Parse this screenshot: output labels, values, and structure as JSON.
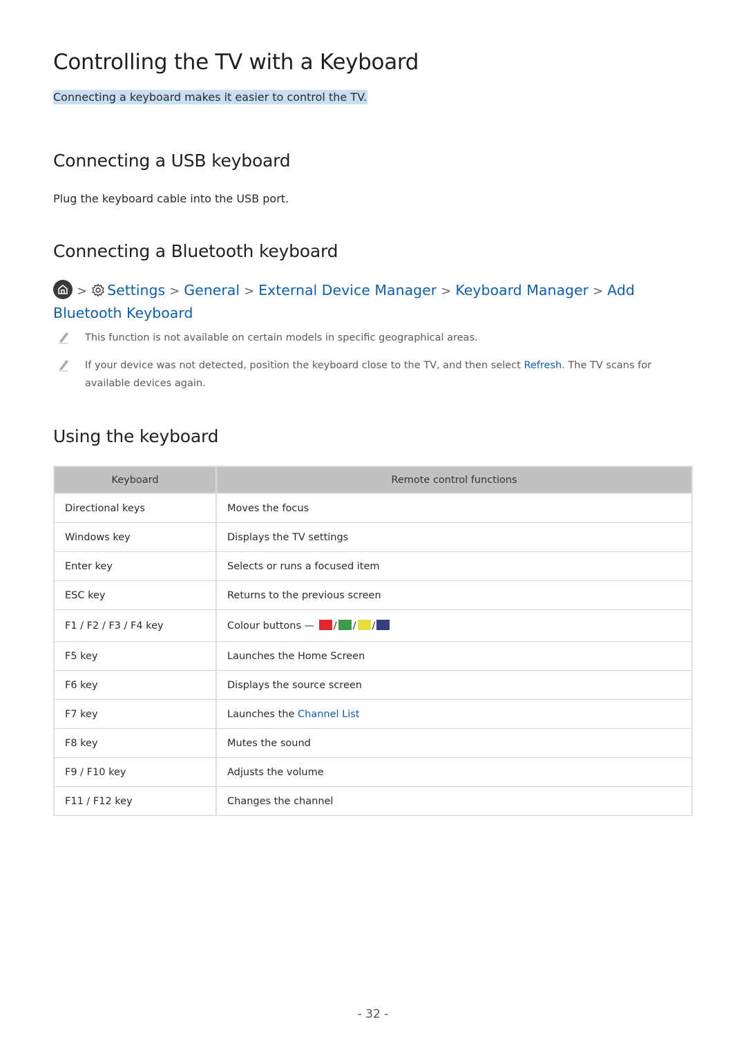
{
  "title": "Controlling the TV with a Keyboard",
  "intro": "Connecting a keyboard makes it easier to control the TV.",
  "sections": {
    "usb": {
      "heading": "Connecting a USB keyboard",
      "text": "Plug the keyboard cable into the USB port."
    },
    "bluetooth": {
      "heading": "Connecting a Bluetooth keyboard",
      "path": {
        "home_icon": "home-icon",
        "settings_icon": "gear-icon",
        "items": [
          "Settings",
          "General",
          "External Device Manager",
          "Keyboard Manager",
          "Add Bluetooth Keyboard"
        ]
      },
      "notes": [
        {
          "icon": "pencil-icon",
          "text": "This function is not available on certain models in specific geographical areas."
        },
        {
          "icon": "pencil-icon",
          "text_before": "If your device was not detected, position the keyboard close to the TV, and then select ",
          "link": "Refresh",
          "text_after": ". The TV scans for available devices again."
        }
      ]
    },
    "using": {
      "heading": "Using the keyboard",
      "table": {
        "headers": [
          "Keyboard",
          "Remote control functions"
        ],
        "rows": [
          {
            "key": "Directional keys",
            "function": "Moves the focus"
          },
          {
            "key": "Windows key",
            "function": "Displays the TV settings"
          },
          {
            "key": "Enter key",
            "function": "Selects or runs a focused item"
          },
          {
            "key": "ESC key",
            "function": "Returns to the previous screen"
          },
          {
            "key": "F1 / F2 / F3 / F4 key",
            "function": "Colour buttons —",
            "swatches": [
              "#e0272e",
              "#3d9a48",
              "#e4df3d",
              "#343e7c"
            ],
            "separator": "/"
          },
          {
            "key": "F5 key",
            "function": "Launches the Home Screen"
          },
          {
            "key": "F6 key",
            "function": "Displays the source screen"
          },
          {
            "key": "F7 key",
            "function": "Launches the ",
            "link": "Channel List"
          },
          {
            "key": "F8 key",
            "function": "Mutes the sound"
          },
          {
            "key": "F9 / F10 key",
            "function": "Adjusts the volume"
          },
          {
            "key": "F11 / F12 key",
            "function": "Changes the channel"
          }
        ]
      }
    }
  },
  "page_number": "- 32 -",
  "colors": {
    "link": "#0f5ea8",
    "highlight": "#c9def3",
    "table_header": "#c0c1c3"
  }
}
